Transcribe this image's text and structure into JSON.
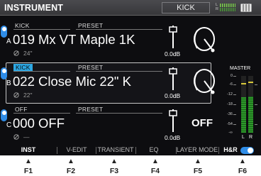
{
  "header": {
    "title": "INSTRUMENT",
    "kit": "KICK",
    "meter_l": "L",
    "meter_r": "R"
  },
  "rows": [
    {
      "slot": "A",
      "kind": "KICK",
      "preset_label": "PRESET",
      "name": "019 Mx VT Maple 1K",
      "size": "24\"",
      "level": "0.0dB",
      "highlighted": false
    },
    {
      "slot": "B",
      "kind": "KICK",
      "preset_label": "PRESET",
      "name": "022 Close Mic 22\" K",
      "size": "22\"",
      "level": "0.0dB",
      "highlighted": true
    },
    {
      "slot": "C",
      "kind": "OFF",
      "preset_label": "PRESET",
      "name": "000 OFF",
      "size": "—",
      "level": "0.0dB",
      "off_label": "OFF"
    }
  ],
  "master": {
    "label": "MASTER",
    "scale": [
      "0",
      "-6",
      "-12",
      "-18",
      "-36",
      "-54",
      "-∞"
    ],
    "l": "L",
    "r": "R",
    "level_l": 0.62,
    "level_r": 0.64
  },
  "tabs": [
    "INST",
    "V-EDIT",
    "TRANSIENT",
    "EQ",
    "LAYER MODE",
    "H&R"
  ],
  "fkeys": [
    "F1",
    "F2",
    "F3",
    "F4",
    "F5",
    "F6"
  ],
  "colors": {
    "accent": "#2f8de8",
    "highlight": "#2da8e4",
    "meter": "#2d9a2a"
  }
}
